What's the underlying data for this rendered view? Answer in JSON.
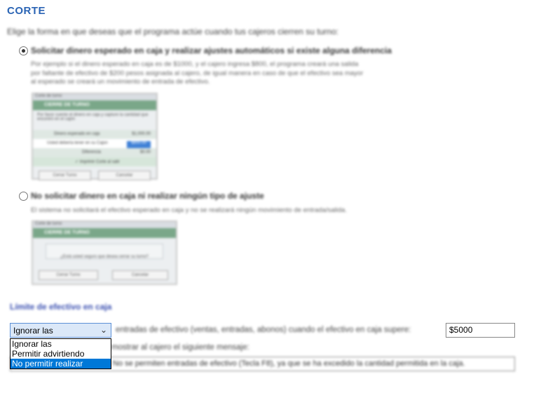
{
  "header": {
    "title": "CORTE"
  },
  "intro": "Elige la forma en que deseas que el programa actúe cuando tus cajeros cierren su turno:",
  "options": [
    {
      "label": "Solicitar dinero esperado en caja y realizar ajustes automáticos si existe alguna diferencia",
      "checked": true,
      "description_lines": [
        "Por ejemplo si el dinero esperado en caja es de $1000, y el cajero ingresa $800, el programa creará una salida",
        "por faltante de efectivo de $200 pesos asignada al cajero, de igual manera en caso de que el efectivo sea mayor",
        "al esperado se creará un movimiento de entrada de efectivo."
      ],
      "thumbnail": {
        "window_title": "Corte de turno",
        "banner": "CIERRE DE TURNO",
        "text": "Por favor cuente el dinero en caja y capture la cantidad que encontró en el cajón",
        "rows": [
          {
            "label": "Dinero esperado en caja",
            "value": "$1,000.00"
          },
          {
            "label": "Usted debería tener en su Cajon",
            "value": "$800.00"
          },
          {
            "label": "Diferencia",
            "value": "$0.00"
          }
        ],
        "check_text": "Imprimir Corte al salir",
        "buttons": [
          "Cerrar Turno",
          "Cancelar"
        ]
      }
    },
    {
      "label": "No solicitar dinero en caja ni realizar ningún tipo de ajuste",
      "checked": false,
      "description_lines": [
        "El sistema no solicitará el efectivo esperado en caja y no se realizará ningún movimiento de entrada/salida."
      ],
      "thumbnail": {
        "window_title": "Corte de turno",
        "banner": "CIERRE DE TURNO",
        "text": "¿Está usted seguro que desea cerrar su turno?",
        "buttons": [
          "Cerrar Turno",
          "Cancelar"
        ]
      }
    }
  ],
  "limit_section": {
    "title": "Límite de efectivo en caja",
    "select_value": "Ignorar las",
    "dropdown_options": [
      "Ignorar las",
      "Permitir advirtiendo",
      "No permitir realizar"
    ],
    "dropdown_selected_index": 2,
    "sentence": "entradas de efectivo (ventas, entradas, abonos) cuando el efectivo en caja supere:",
    "amount": "$5000",
    "message_prefix": "y mostrar al cajero el siguiente mensaje:",
    "message_value": "No se permiten entradas de efectivo (Tecla F8), ya que se ha excedido la cantidad permitida en la caja."
  }
}
